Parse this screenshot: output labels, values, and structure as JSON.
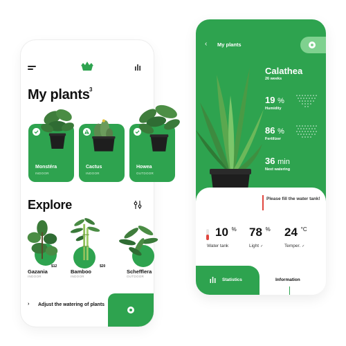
{
  "left_screen": {
    "title": "My plants",
    "plant_count": "3",
    "cards": [
      {
        "name": "Monstéra",
        "location": "INDOOR",
        "status": "ok"
      },
      {
        "name": "Cactus",
        "location": "INDOOR",
        "status": "warning"
      },
      {
        "name": "Howea",
        "location": "OUTDOOR",
        "status": "ok"
      }
    ],
    "explore_title": "Explore",
    "explore_items": [
      {
        "name": "Gazania",
        "price": "$12",
        "location": "INDOOR"
      },
      {
        "name": "Bamboo",
        "price": "$20",
        "location": "INDOOR"
      },
      {
        "name": "Schefflera",
        "price": "",
        "location": "OUTDOOR"
      }
    ],
    "reminder_chevron": "›",
    "reminder_text": "Adjust the watering of plants"
  },
  "right_screen": {
    "header": "My plants",
    "back_chevron": "‹",
    "plant_name": "Calathea",
    "plant_age": "26 weeks",
    "metrics": [
      {
        "value": "19",
        "unit": "%",
        "label": "Humidity"
      },
      {
        "value": "86",
        "unit": "%",
        "label": "Fertilizer"
      },
      {
        "value": "36",
        "unit": "min",
        "label": "Next watering"
      }
    ],
    "alert_text": "Please fill the water tank!",
    "sensors": [
      {
        "value": "10",
        "unit": "%",
        "label": "Water tank",
        "check": ""
      },
      {
        "value": "78",
        "unit": "%",
        "label": "Light",
        "check": "✓"
      },
      {
        "value": "24",
        "unit": "°C",
        "label": "Temper.",
        "check": "✓"
      }
    ],
    "tabs": {
      "statistics": "Statistics",
      "information": "Information"
    }
  },
  "colors": {
    "brand_green": "#2ea34f",
    "light_green": "#7fd18f",
    "alert_red": "#e0463e",
    "pot_black": "#1e1e1e"
  }
}
